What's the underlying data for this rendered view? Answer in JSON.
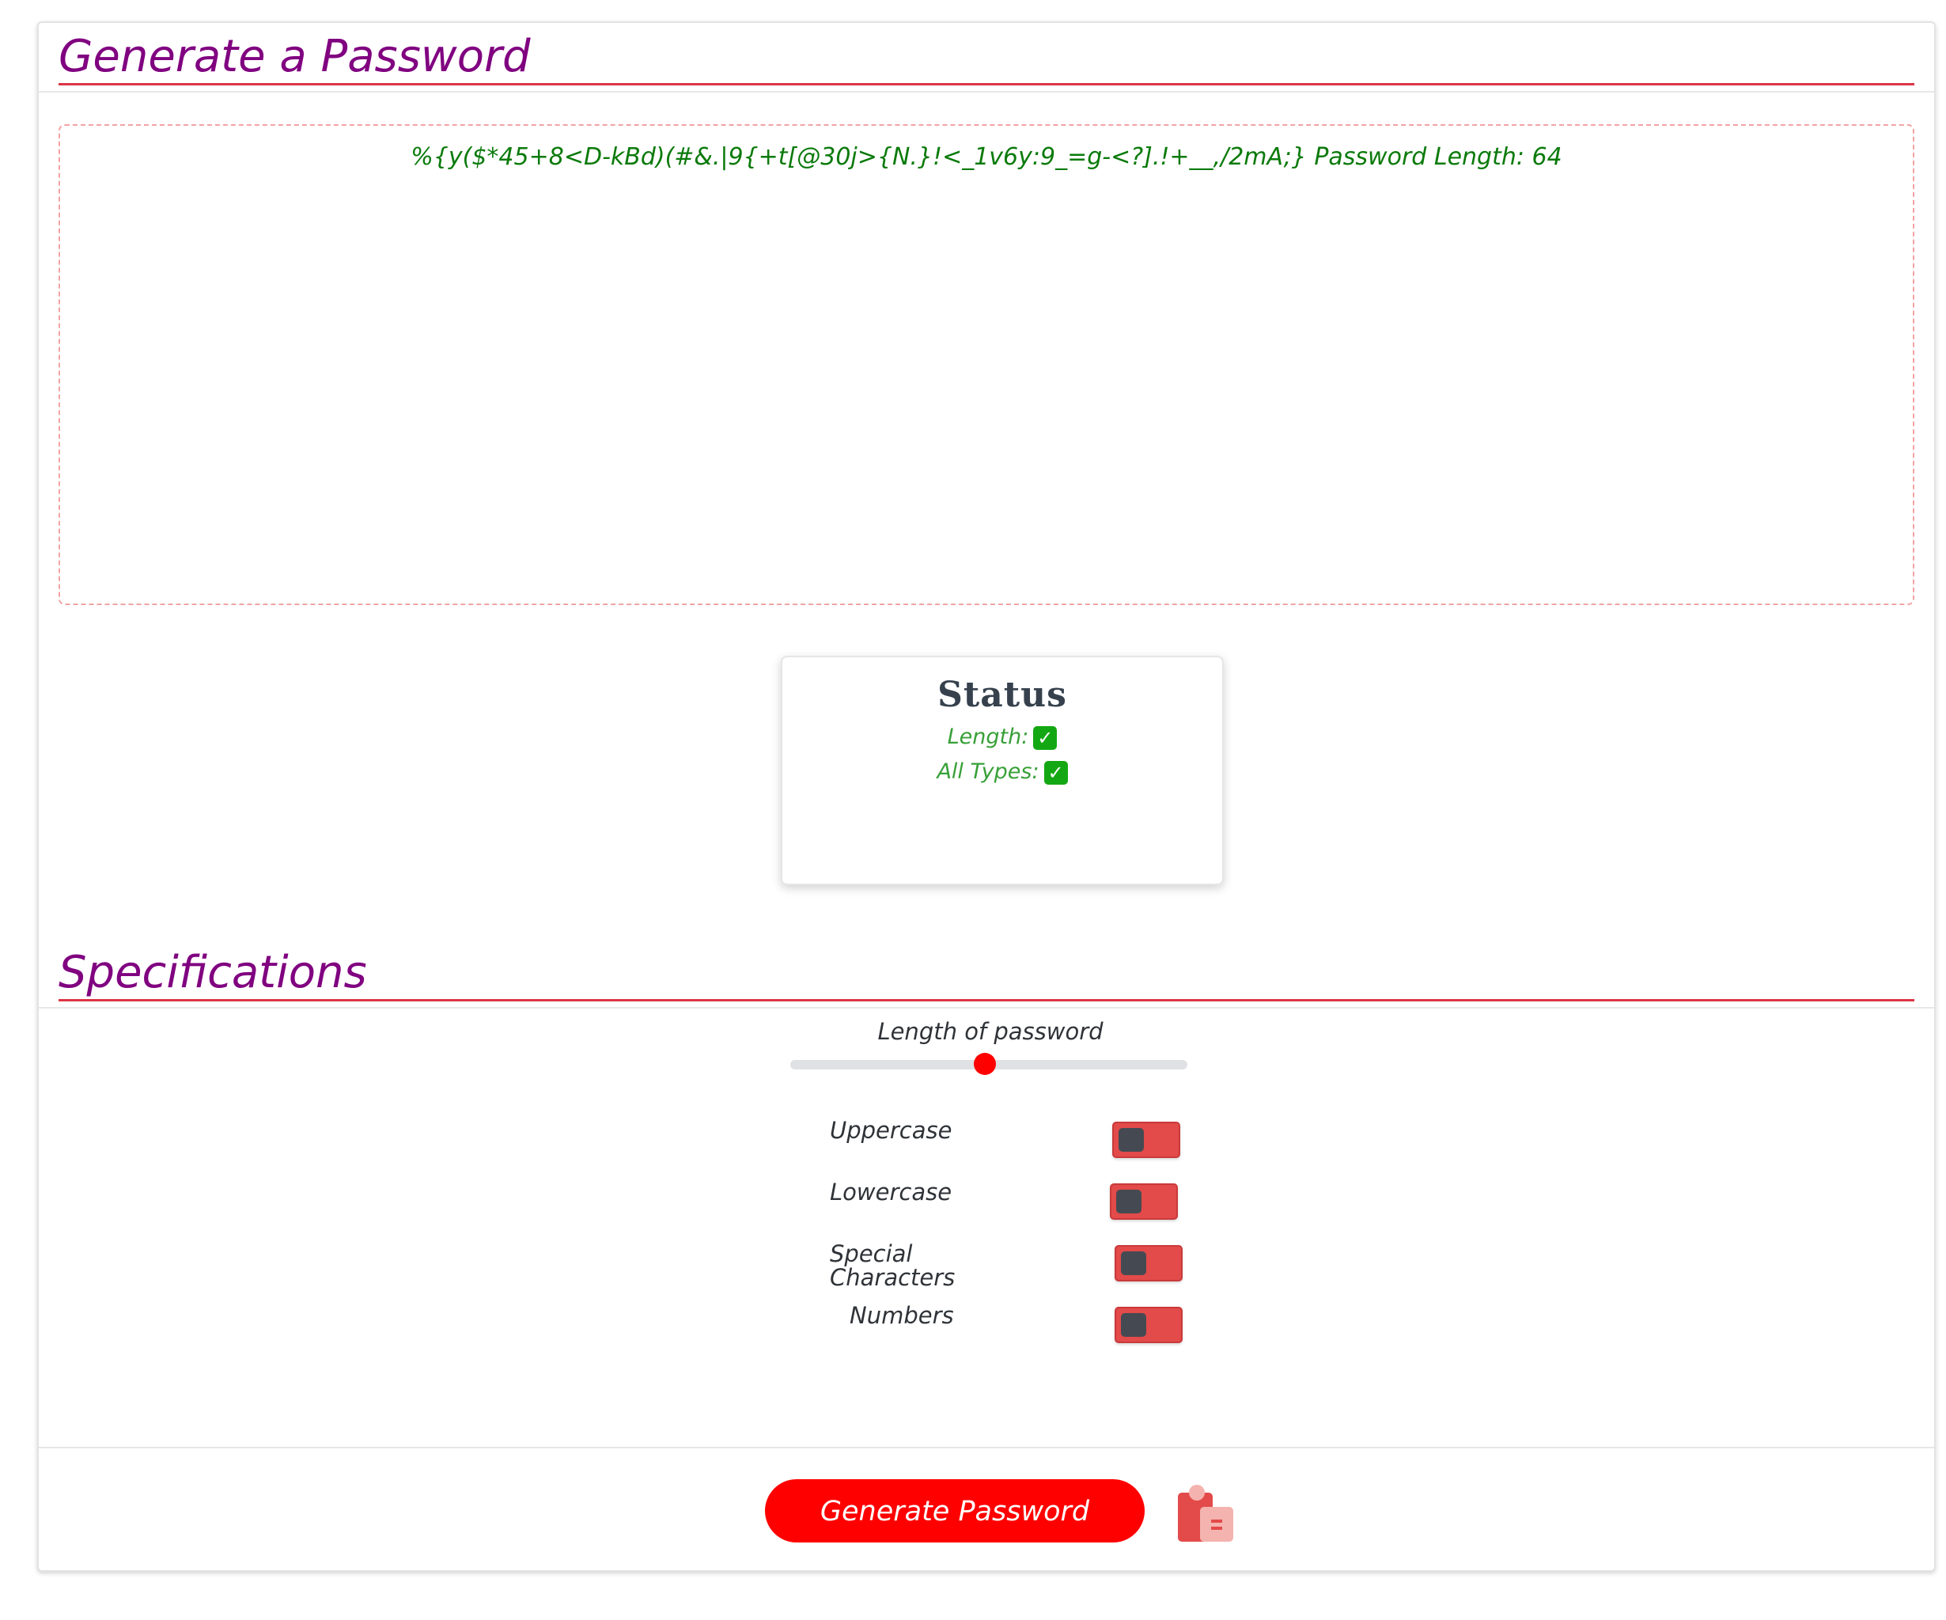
{
  "header": {
    "title": "Generate a Password"
  },
  "password": {
    "text": "%{y($*45+8<D-kBd)(#&.|9{+t[@30j>{N.}!<_1v6y:9_=g-<?].!+__,/2mA;} Password Length: 64"
  },
  "status": {
    "title": "Status",
    "length_label": "Length:",
    "all_types_label": "All Types:",
    "length_ok": "✓",
    "all_types_ok": "✓"
  },
  "specifications": {
    "title": "Specifications",
    "slider_label": "Length of password",
    "slider_value_fraction": 0.5,
    "options": [
      {
        "label": "Uppercase",
        "enabled": false
      },
      {
        "label": "Lowercase",
        "enabled": false
      },
      {
        "label_line1": "Special",
        "label_line2": "Characters",
        "enabled": false
      },
      {
        "label": "Numbers",
        "enabled": false
      }
    ]
  },
  "footer": {
    "generate_label": "Generate Password",
    "copy_icon": "clipboard-icon"
  },
  "colors": {
    "heading": "#800080",
    "accent_red": "#ff0000",
    "toggle_red": "#e34a4a",
    "password_green": "#0b7a0b",
    "status_green": "#38a038"
  }
}
